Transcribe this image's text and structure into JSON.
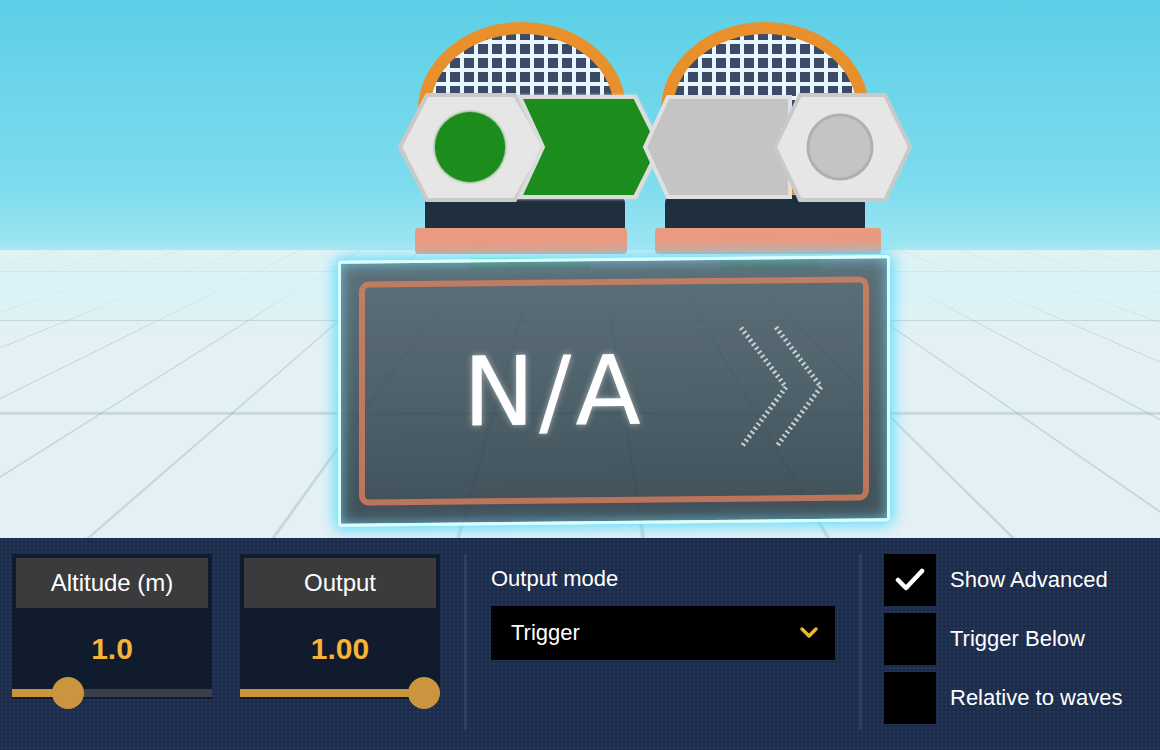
{
  "scene": {
    "display": {
      "text": "N/A"
    },
    "ports": [
      {
        "name": "input",
        "active": true,
        "color": "#1e8c1e"
      },
      {
        "name": "output",
        "active": false,
        "color": "#c4c4c4"
      }
    ]
  },
  "sliders": [
    {
      "label": "Altitude (m)",
      "value": "1.0",
      "level": 0.24
    },
    {
      "label": "Output",
      "value": "1.00",
      "level": 1.0
    }
  ],
  "output_mode": {
    "label": "Output mode",
    "value": "Trigger"
  },
  "checkboxes": [
    {
      "label": "Show Advanced",
      "checked": true
    },
    {
      "label": "Trigger Below",
      "checked": false
    },
    {
      "label": "Relative to waves",
      "checked": false
    }
  ]
}
